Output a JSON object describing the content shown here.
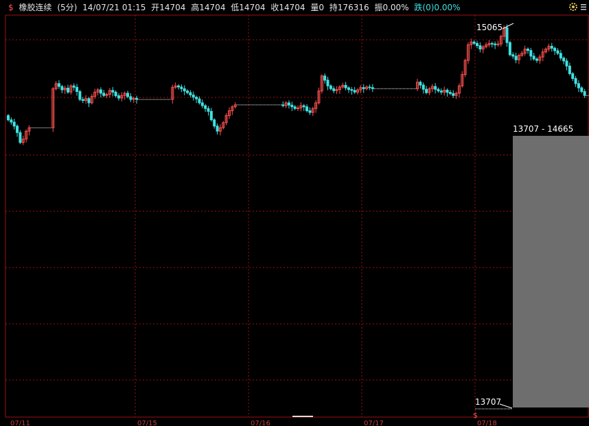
{
  "header": {
    "symbol_icon": "dollar-icon",
    "name": "橡胶连续",
    "period": "(5分)",
    "datetime": "14/07/21 01:15",
    "open": "开14704",
    "high": "高14704",
    "low": "低14704",
    "close": "收14704",
    "volume": "量0",
    "open_interest": "持176316",
    "amplitude": "振0.00%",
    "change": "跌(0)0.00%"
  },
  "annotations": {
    "high_label": "15065",
    "low_label": "13707",
    "range_label": "13707 - 14665"
  },
  "x_axis_labels": [
    "07/11",
    "07/15",
    "07/16",
    "07/17",
    "07/18"
  ],
  "colors": {
    "background": "#000000",
    "grid": "#a01010",
    "up": "#ff5050",
    "down": "#40e0e0",
    "flat": "#ffffff",
    "range_box": "#6e6e6e"
  },
  "chart_data": {
    "type": "candlestick",
    "instrument": "橡胶连续",
    "interval": "5分",
    "max_visible": 15065,
    "min_visible": 13707,
    "ylim": [
      13690,
      15110
    ],
    "dates": [
      "07/11",
      "07/15",
      "07/16",
      "07/17",
      "07/18"
    ],
    "close_series": [
      14740,
      14732,
      14718,
      14695,
      14660,
      14672,
      14700,
      14712,
      14712,
      14712,
      14712,
      14712,
      14712,
      14712,
      14712,
      14850,
      14868,
      14858,
      14846,
      14852,
      14838,
      14860,
      14855,
      14840,
      14812,
      14808,
      14815,
      14800,
      14823,
      14838,
      14846,
      14834,
      14826,
      14830,
      14844,
      14838,
      14825,
      14817,
      14826,
      14834,
      14822,
      14812,
      14816,
      14812,
      14812,
      14812,
      14812,
      14812,
      14812,
      14812,
      14812,
      14812,
      14812,
      14812,
      14812,
      14855,
      14860,
      14856,
      14850,
      14842,
      14836,
      14828,
      14820,
      14814,
      14800,
      14790,
      14780,
      14770,
      14740,
      14718,
      14700,
      14712,
      14730,
      14755,
      14772,
      14786,
      14793,
      14793,
      14793,
      14793,
      14793,
      14793,
      14793,
      14793,
      14793,
      14793,
      14793,
      14793,
      14793,
      14793,
      14793,
      14793,
      14790,
      14800,
      14792,
      14786,
      14780,
      14782,
      14790,
      14786,
      14772,
      14766,
      14780,
      14800,
      14842,
      14895,
      14880,
      14860,
      14850,
      14843,
      14847,
      14856,
      14862,
      14853,
      14847,
      14844,
      14838,
      14846,
      14854,
      14850,
      14856,
      14854,
      14850,
      14850,
      14850,
      14850,
      14850,
      14850,
      14850,
      14850,
      14850,
      14850,
      14850,
      14850,
      14850,
      14850,
      14850,
      14873,
      14863,
      14848,
      14836,
      14850,
      14858,
      14848,
      14842,
      14838,
      14845,
      14837,
      14833,
      14826,
      14834,
      14860,
      14900,
      14950,
      15005,
      15015,
      15010,
      15002,
      14990,
      14998,
      15005,
      15010,
      15008,
      15005,
      15008,
      15035,
      15065,
      15013,
      14970,
      14965,
      14952,
      14968,
      14975,
      14990,
      14985,
      14965,
      14955,
      14950,
      14962,
      14980,
      14990,
      15000,
      14993,
      14984,
      14975,
      14958,
      14948,
      14930,
      14903,
      14886,
      14868,
      14853,
      14840,
      14826,
      14826
    ]
  }
}
